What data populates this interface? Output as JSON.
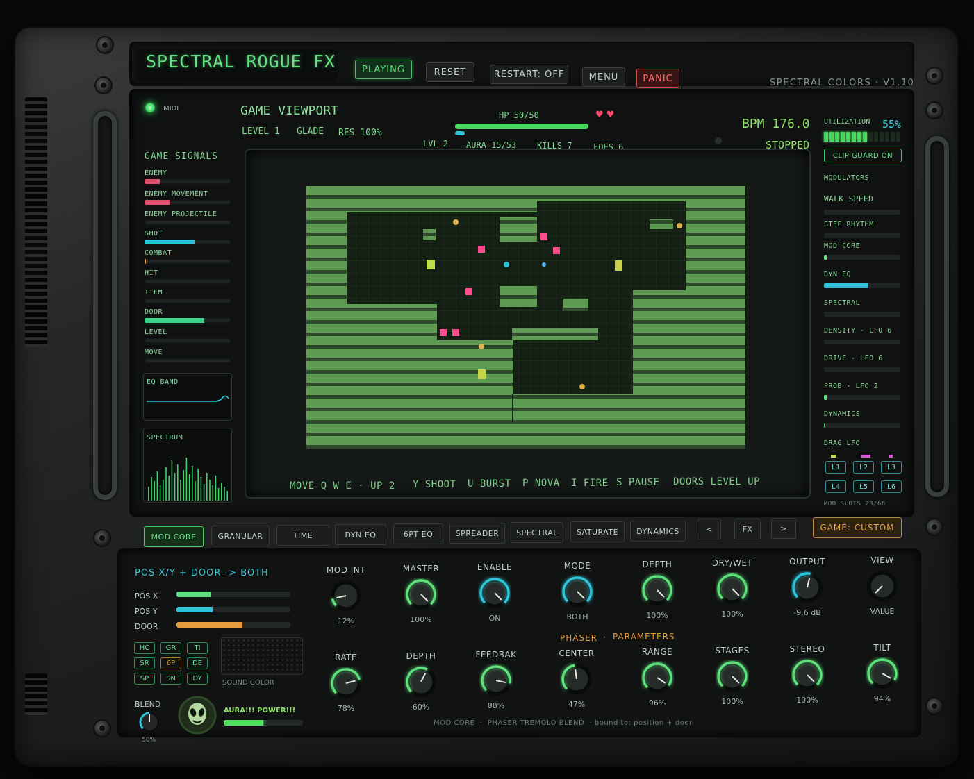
{
  "colors": {
    "accent_green": "#5ee07c",
    "accent_cyan": "#2ec3d6",
    "accent_pink": "#e0506e",
    "accent_orange": "#e69b3c"
  },
  "header": {
    "logo": "SPECTRAL ROGUE FX",
    "buttons": {
      "playing": "PLAYING",
      "reset": "RESET",
      "restart": "RESTART: OFF",
      "menu": "MENU",
      "panic": "PANIC"
    },
    "brand": "SPECTRAL COLORS · V1.10"
  },
  "midi": {
    "label": "MIDI",
    "led_icon": "led-icon"
  },
  "signals": {
    "title": "GAME SIGNALS",
    "items": [
      {
        "label": "ENEMY",
        "level": 0.18,
        "color": "#e0506e"
      },
      {
        "label": "ENEMY MOVEMENT",
        "level": 0.3,
        "color": "#e0506e"
      },
      {
        "label": "ENEMY PROJECTILE",
        "level": 0.0,
        "color": "#e0506e"
      },
      {
        "label": "SHOT",
        "level": 0.58,
        "color": "#2ec3d6"
      },
      {
        "label": "COMBAT",
        "level": 0.02,
        "color": "#e69b3c"
      },
      {
        "label": "HIT",
        "level": 0.0,
        "color": "#e0506e"
      },
      {
        "label": "ITEM",
        "level": 0.0,
        "color": "#5ee07c"
      },
      {
        "label": "DOOR",
        "level": 0.69,
        "color": "#3cd58a"
      },
      {
        "label": "LEVEL",
        "level": 0.0,
        "color": "#5ee07c"
      },
      {
        "label": "MOVE",
        "level": 0.0,
        "color": "#5ee07c"
      }
    ],
    "eq_band": "EQ BAND",
    "spectrum": "SPECTRUM"
  },
  "viewport": {
    "title": "GAME VIEWPORT",
    "level": "LEVEL 1",
    "zone": "GLADE",
    "res": "RES 100%",
    "hp": "HP 50/50",
    "hp_level": 1.0,
    "stats": {
      "lvl": "LVL 2",
      "aura": "AURA 15/53",
      "kills": "KILLS 7",
      "foes": "FOES 6"
    },
    "bpm": "BPM 176.0",
    "state": "STOPPED",
    "controls": [
      "MOVE Q W E · UP 2",
      "Y SHOOT",
      "U BURST",
      "P NOVA",
      "I FIRE",
      "S PAUSE",
      "DOORS LEVEL UP"
    ]
  },
  "right": {
    "utilization_label": "UTILIZATION",
    "utilization_value": "55%",
    "utilization_level": 0.55,
    "clip_guard": "CLIP GUARD ON",
    "modulators_title": "MODULATORS",
    "walk_speed": "WALK SPEED",
    "mods": [
      {
        "label": "STEP RHYTHM",
        "level": 0.0,
        "color": "#5ee07c"
      },
      {
        "label": "MOD CORE",
        "level": 0.04,
        "color": "#5ee07c"
      },
      {
        "label": "DYN EQ",
        "level": 0.58,
        "color": "#2ec3d6"
      },
      {
        "label": "SPECTRAL",
        "level": 0.0,
        "color": "#5ee07c"
      },
      {
        "label": "DENSITY · LFO 6",
        "level": 0.0,
        "color": "#5ee07c"
      },
      {
        "label": "DRIVE · LFO 6",
        "level": 0.0,
        "color": "#5ee07c"
      },
      {
        "label": "PROB · LFO 2",
        "level": 0.04,
        "color": "#5ee07c"
      },
      {
        "label": "DYNAMICS",
        "level": 0.02,
        "color": "#5ee07c"
      }
    ],
    "drag_lfo": "DRAG LFO",
    "lfos": [
      "L1",
      "L2",
      "L3",
      "L4",
      "L5",
      "L6"
    ],
    "mod_slots": "MOD SLOTS 23/66"
  },
  "tabs": [
    "MOD CORE",
    "GRANULAR",
    "TIME",
    "DYN EQ",
    "6PT EQ",
    "SPREADER",
    "SPECTRAL",
    "SATURATE",
    "DYNAMICS"
  ],
  "nav": {
    "prev": "<",
    "fx": "FX",
    "next": ">"
  },
  "game_preset": "GAME: CUSTOM",
  "lower": {
    "pos_title": "POS X/Y + DOOR -> BOTH",
    "pos": [
      {
        "label": "POS X",
        "level": 0.3,
        "color": "#5ee07c"
      },
      {
        "label": "POS Y",
        "level": 0.32,
        "color": "#2ec3d6"
      },
      {
        "label": "DOOR",
        "level": 0.58,
        "color": "#e69b3c"
      }
    ],
    "mini_buttons": [
      "HC",
      "GR",
      "TI",
      "SR",
      "6P",
      "DE",
      "SP",
      "SN",
      "DY"
    ],
    "sound_color": "SOUND COLOR",
    "blend_label": "BLEND",
    "blend_value": "50%",
    "power_label": "AURA!!! POWER!!!",
    "power_level": 0.5,
    "top_knobs": [
      {
        "label": "MOD INT",
        "value": "12%"
      },
      {
        "label": "MASTER",
        "value": "100%"
      },
      {
        "label": "ENABLE",
        "value": "ON"
      },
      {
        "label": "MODE",
        "value": "BOTH"
      },
      {
        "label": "DEPTH",
        "value": "100%"
      },
      {
        "label": "DRY/WET",
        "value": "100%"
      },
      {
        "label": "OUTPUT",
        "value": "-9.6 dB"
      },
      {
        "label": "VIEW",
        "value": "VALUE"
      }
    ],
    "phaser": "PHASER",
    "parameters": "PARAMETERS",
    "bottom_knobs": [
      {
        "label": "RATE",
        "value": "78%"
      },
      {
        "label": "DEPTH",
        "value": "60%"
      },
      {
        "label": "FEEDBAK",
        "value": "88%"
      },
      {
        "label": "CENTER",
        "value": "47%"
      },
      {
        "label": "RANGE",
        "value": "96%"
      },
      {
        "label": "STAGES",
        "value": "100%"
      },
      {
        "label": "STEREO",
        "value": "100%"
      },
      {
        "label": "TILT",
        "value": "94%"
      }
    ],
    "footer": "MOD CORE  ·  PHASER TREMOLO BLEND  · bound to: position + door"
  }
}
